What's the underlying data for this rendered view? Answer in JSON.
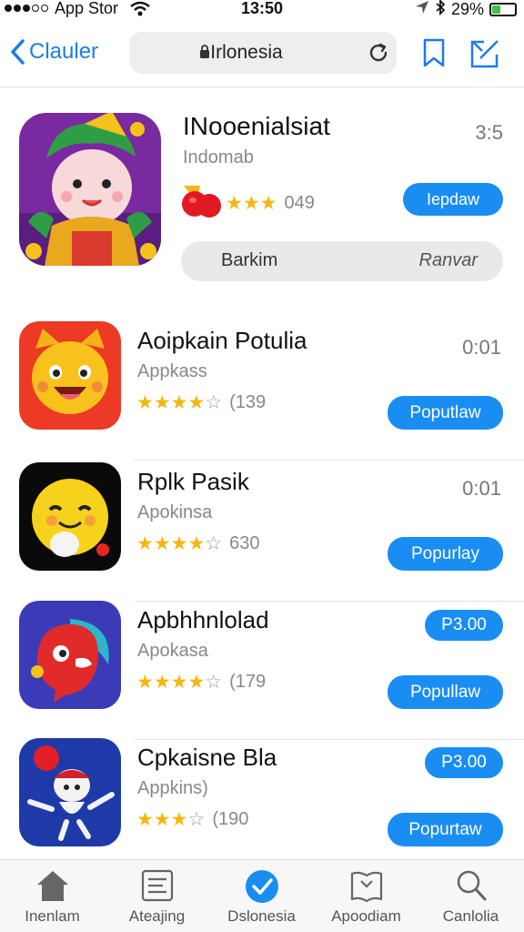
{
  "status_bar": {
    "carrier": "App Stor",
    "time": "13:50",
    "battery": "29%"
  },
  "nav": {
    "back_label": "Clauler",
    "search_text": "Irlonesia",
    "icons": [
      "chevron-left-icon",
      "lock-icon",
      "reload-icon",
      "bookmark-icon",
      "compose-icon"
    ]
  },
  "featured": {
    "title": "INooenialsiat",
    "subtitle": "Indomab",
    "time": "3:5",
    "rating_stars": 3,
    "rating_count": "049",
    "update_label": "Iepdaw",
    "pill_left": "Barkim",
    "pill_right": "Ranvar"
  },
  "apps": [
    {
      "name": "Aoipkain Potulia",
      "category": "Appkass",
      "stars": 4,
      "count": "(139",
      "right_text": "0:01",
      "right_type": "time",
      "button": "Poputlaw"
    },
    {
      "name": "Rplk Pasik",
      "category": "Apokinsa",
      "stars": 4,
      "count": "630",
      "right_text": "0:01",
      "right_type": "time",
      "button": "Popurlay"
    },
    {
      "name": "Apbhhnlolad",
      "category": "Apokasa",
      "stars": 4,
      "count": "(179",
      "right_text": "P3.00",
      "right_type": "price",
      "button": "Popullaw"
    },
    {
      "name": "Cpkaisne Bla",
      "category": "Appkins)",
      "stars": 3,
      "count": "(190",
      "right_text": "P3.00",
      "right_type": "price",
      "button": "Popurtaw"
    }
  ],
  "tabs": [
    {
      "label": "Inenlam",
      "icon": "home-icon"
    },
    {
      "label": "Ateajing",
      "icon": "list-icon"
    },
    {
      "label": "Dslonesia",
      "icon": "checkmark-icon",
      "active": true
    },
    {
      "label": "Apoodiam",
      "icon": "book-icon"
    },
    {
      "label": "Canlolia",
      "icon": "search-icon"
    }
  ],
  "colors": {
    "accent": "#1a8df3",
    "star": "#f5b70f",
    "battery": "#3ec43e"
  }
}
